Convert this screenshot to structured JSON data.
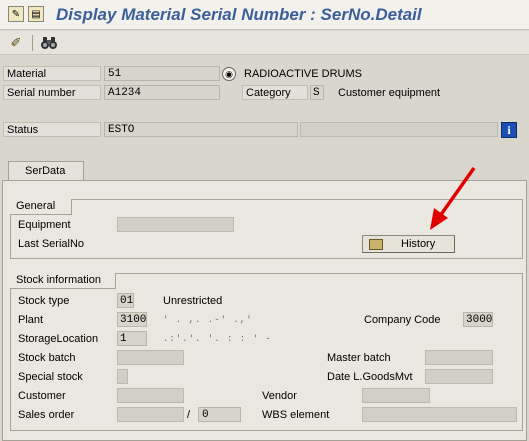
{
  "window": {
    "title": "Display Material Serial Number : SerNo.Detail"
  },
  "toolbar": {
    "icons": [
      "edit-pencil-icon",
      "find-binoculars-icon"
    ]
  },
  "header": {
    "material_label": "Material",
    "material_value": "51",
    "material_desc": "RADIOACTIVE DRUMS",
    "serial_label": "Serial number",
    "serial_value": "A1234",
    "category_label": "Category",
    "category_value": "S",
    "category_desc": "Customer equipment",
    "status_label": "Status",
    "status_value": "ESTO",
    "status_value2": ""
  },
  "tabs": [
    {
      "label": "SerData"
    }
  ],
  "general": {
    "title": "General",
    "equipment_label": "Equipment",
    "equipment_value": "",
    "last_serial_label": "Last SerialNo",
    "history_button": "History"
  },
  "stock": {
    "title": "Stock information",
    "stock_type_label": "Stock type",
    "stock_type_value": "01",
    "stock_type_desc": "Unrestricted",
    "plant_label": "Plant",
    "plant_value": "3100",
    "plant_desc": "' . ,. .-' .,'",
    "company_code_label": "Company Code",
    "company_code_value": "3000",
    "storage_location_label": "StorageLocation",
    "storage_location_value": "1",
    "storage_location_desc": ".:'.'. '.  : :  ' -",
    "stock_batch_label": "Stock batch",
    "master_batch_label": "Master batch",
    "special_stock_label": "Special stock",
    "date_goods_mvt_label": "Date L.GoodsMvt",
    "customer_label": "Customer",
    "vendor_label": "Vendor",
    "sales_order_label": "Sales order",
    "sales_order_sep": "/",
    "sales_order_item": "0",
    "wbs_label": "WBS element"
  },
  "colors": {
    "title": "#3a5f9a",
    "arrow": "#e00000",
    "background": "#d9d6cd"
  }
}
